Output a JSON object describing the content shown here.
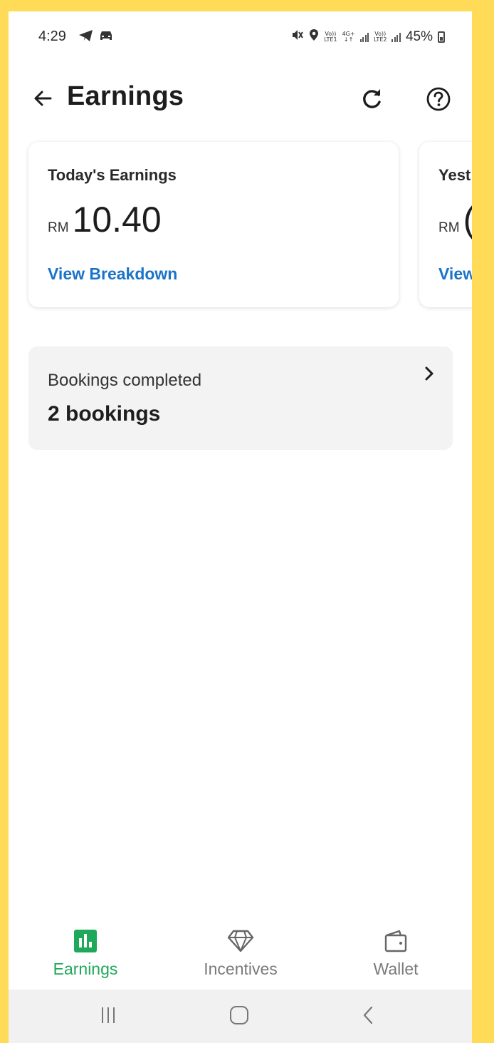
{
  "status_bar": {
    "time": "4:29",
    "battery": "45%",
    "sim1": {
      "top": "Vo))",
      "bottom": "LTE1"
    },
    "net": {
      "top": "4G+",
      "bottom": "↓↑"
    },
    "sim2": {
      "top": "Vo))",
      "bottom": "LTE2"
    },
    "icons": [
      "telegram-icon",
      "car-icon",
      "mute-icon",
      "location-icon",
      "signal-icon",
      "battery-icon"
    ]
  },
  "header": {
    "title": "Earnings",
    "icons": [
      "back-arrow-icon",
      "refresh-icon",
      "help-icon"
    ]
  },
  "earnings_cards": [
    {
      "label": "Today's Earnings",
      "currency": "RM",
      "amount": "10.40",
      "link": "View Breakdown"
    },
    {
      "label": "Yest",
      "currency": "RM",
      "amount": "(",
      "link": "View"
    }
  ],
  "bookings": {
    "label": "Bookings completed",
    "value": "2 bookings"
  },
  "bottom_nav": {
    "items": [
      {
        "label": "Earnings",
        "icon": "bar-chart-icon",
        "active": true
      },
      {
        "label": "Incentives",
        "icon": "diamond-icon",
        "active": false
      },
      {
        "label": "Wallet",
        "icon": "wallet-icon",
        "active": false
      }
    ]
  },
  "system_nav": {
    "icons": [
      "recent-apps-icon",
      "home-icon",
      "back-icon"
    ]
  },
  "colors": {
    "frame_border": "#FFDB58",
    "accent_green": "#1EA85A",
    "link_blue": "#1A73C8",
    "card_gray": "#F3F3F3"
  }
}
